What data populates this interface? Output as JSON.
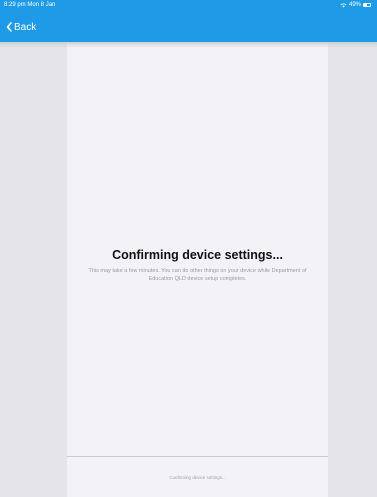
{
  "status_bar": {
    "time": "8:29 pm  Mon 8 Jan",
    "battery_percent": "49%",
    "battery_level": 0.49
  },
  "nav": {
    "back_label": "Back"
  },
  "main": {
    "title": "Confirming device settings...",
    "subtitle": "This may take a few minutes.  You can do other things on your device while Department of Education QLD device setup completes."
  },
  "footer": {
    "status_text": "Confirming device settings..."
  },
  "colors": {
    "nav_background": "#1f9ae6",
    "panel_background": "#f2f2f7",
    "side_background": "#e4e4e9"
  },
  "icons": [
    "wifi-icon",
    "battery-icon",
    "chevron-left-icon"
  ]
}
